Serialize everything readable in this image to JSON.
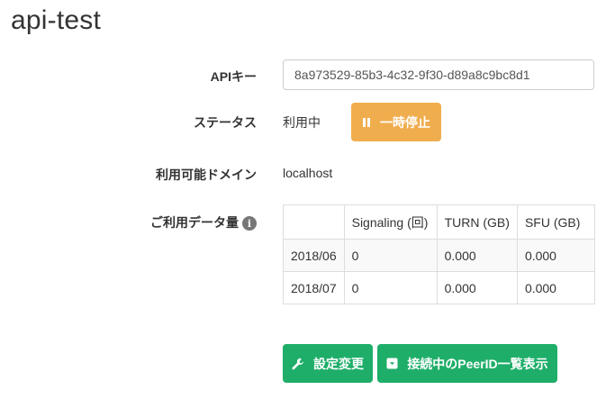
{
  "page": {
    "title": "api-test"
  },
  "fields": {
    "api_key_label": "APIキー",
    "api_key_value": "8a973529-85b3-4c32-9f30-d89a8c9bc8d1",
    "status_label": "ステータス",
    "status_value": "利用中",
    "pause_button_label": "一時停止",
    "domains_label": "利用可能ドメイン",
    "domains_value": "localhost",
    "usage_label": "ご利用データ量",
    "info_icon_glyph": "i"
  },
  "usage_table": {
    "headers": [
      "",
      "Signaling (回)",
      "TURN (GB)",
      "SFU (GB)"
    ],
    "rows": [
      [
        "2018/06",
        "0",
        "0.000",
        "0.000"
      ],
      [
        "2018/07",
        "0",
        "0.000",
        "0.000"
      ]
    ]
  },
  "actions": {
    "settings_button_label": "設定変更",
    "peers_button_label": "接続中のPeerID一覧表示"
  },
  "colors": {
    "warning": "#f0ad4e",
    "success": "#1fae69",
    "info_icon": "#777777"
  },
  "icons": {
    "pause": "pause-icon",
    "wrench": "wrench-icon",
    "download_box": "download-box-icon",
    "info": "info-icon"
  }
}
